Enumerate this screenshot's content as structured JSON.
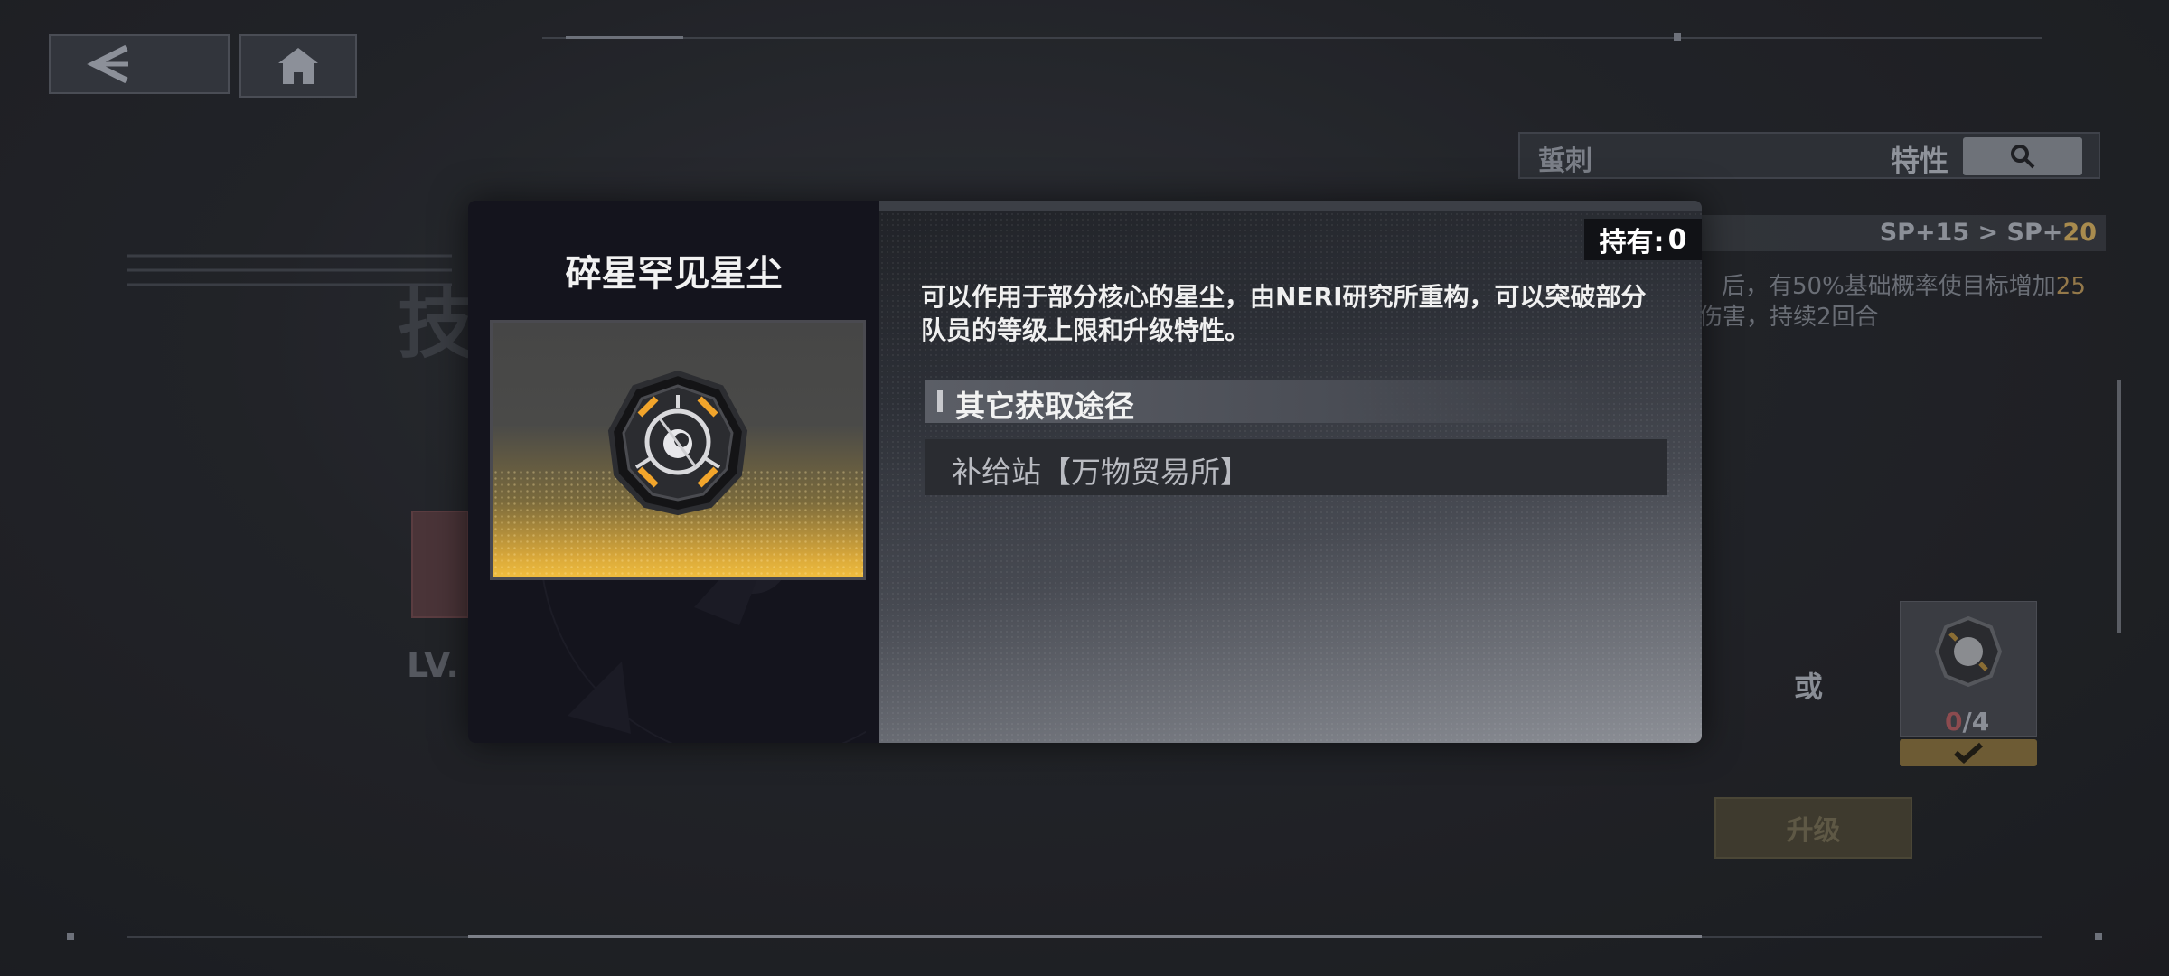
{
  "top_bar": {
    "back_icon": "chevron-left-icon",
    "home_icon": "home-icon"
  },
  "background": {
    "tag_label": "蜇刺",
    "trait_label": "特性",
    "search_icon": "search-icon",
    "sp_before": "SP+15 > SP+",
    "sp_after": "20",
    "desc_line1_a": "后，有50%基础概率使目标增加",
    "desc_line1_b": "25",
    "desc_line2": "伤害，持续2回合",
    "skill_title_partial": "技",
    "level_partial": "LV.",
    "or_label": "或",
    "material_count_have": "0",
    "material_count_need": "/4",
    "upgrade_label": "升级"
  },
  "modal": {
    "item_name": "碎星罕见星尘",
    "item_icon": "stardust-core-icon",
    "owned_label": "持有:",
    "owned_value": "0",
    "description": "可以作用于部分核心的星尘，由NERI研究所重构，可以突破部分队员的等级上限和升级特性。",
    "sources_header": "其它获取途径",
    "sources": [
      "补给站【万物贸易所】"
    ]
  },
  "colors": {
    "accent_gold": "#f0bd3e",
    "modal_left_bg": "#14141d",
    "text_primary": "#f2f2f2"
  }
}
